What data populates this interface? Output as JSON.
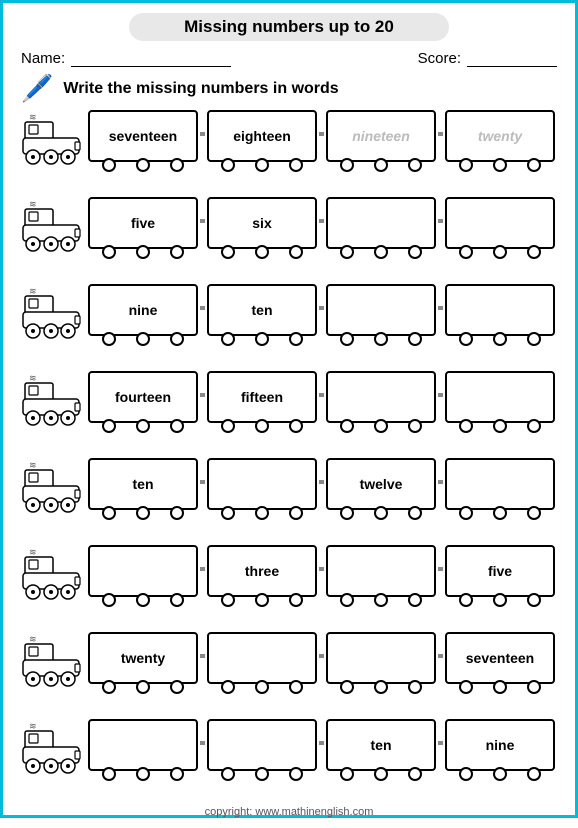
{
  "title": "Missing numbers up to 20",
  "name_label": "Name:",
  "score_label": "Score:",
  "instruction": "Write the missing numbers in words",
  "rows": [
    {
      "cars": [
        {
          "text": "seventeen",
          "ghost": false,
          "empty": false
        },
        {
          "text": "eighteen",
          "ghost": false,
          "empty": false
        },
        {
          "text": "nineteen",
          "ghost": true,
          "empty": false
        },
        {
          "text": "twenty",
          "ghost": true,
          "empty": false
        }
      ]
    },
    {
      "cars": [
        {
          "text": "five",
          "ghost": false,
          "empty": false
        },
        {
          "text": "six",
          "ghost": false,
          "empty": false
        },
        {
          "text": "",
          "ghost": false,
          "empty": true
        },
        {
          "text": "",
          "ghost": false,
          "empty": true
        }
      ]
    },
    {
      "cars": [
        {
          "text": "nine",
          "ghost": false,
          "empty": false
        },
        {
          "text": "ten",
          "ghost": false,
          "empty": false
        },
        {
          "text": "",
          "ghost": false,
          "empty": true
        },
        {
          "text": "",
          "ghost": false,
          "empty": true
        }
      ]
    },
    {
      "cars": [
        {
          "text": "fourteen",
          "ghost": false,
          "empty": false
        },
        {
          "text": "fifteen",
          "ghost": false,
          "empty": false
        },
        {
          "text": "",
          "ghost": false,
          "empty": true
        },
        {
          "text": "",
          "ghost": false,
          "empty": true
        }
      ]
    },
    {
      "cars": [
        {
          "text": "ten",
          "ghost": false,
          "empty": false
        },
        {
          "text": "",
          "ghost": false,
          "empty": true
        },
        {
          "text": "twelve",
          "ghost": false,
          "empty": false
        },
        {
          "text": "",
          "ghost": false,
          "empty": true
        }
      ]
    },
    {
      "cars": [
        {
          "text": "",
          "ghost": false,
          "empty": true
        },
        {
          "text": "three",
          "ghost": false,
          "empty": false
        },
        {
          "text": "",
          "ghost": false,
          "empty": true
        },
        {
          "text": "five",
          "ghost": false,
          "empty": false
        }
      ]
    },
    {
      "cars": [
        {
          "text": "twenty",
          "ghost": false,
          "empty": false
        },
        {
          "text": "",
          "ghost": false,
          "empty": true
        },
        {
          "text": "",
          "ghost": false,
          "empty": true
        },
        {
          "text": "seventeen",
          "ghost": false,
          "empty": false
        }
      ]
    },
    {
      "cars": [
        {
          "text": "",
          "ghost": false,
          "empty": true
        },
        {
          "text": "",
          "ghost": false,
          "empty": true
        },
        {
          "text": "ten",
          "ghost": false,
          "empty": false
        },
        {
          "text": "nine",
          "ghost": false,
          "empty": false
        }
      ]
    }
  ],
  "copyright": "copyright:   www.mathinenglish.com"
}
